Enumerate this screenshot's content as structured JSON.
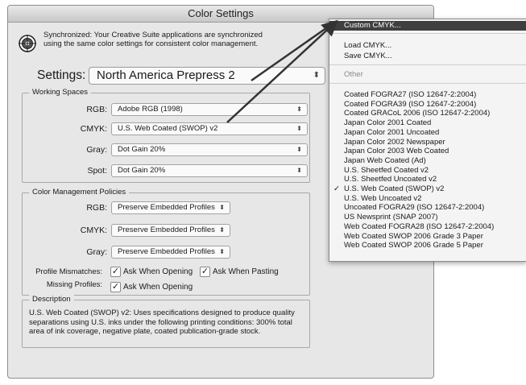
{
  "window": {
    "title": "Color Settings"
  },
  "sync": {
    "line1": "Synchronized: Your Creative Suite applications are synchronized",
    "line2": "using the same color settings for consistent color management."
  },
  "settings": {
    "label": "Settings:",
    "value": "North America Prepress 2"
  },
  "working_spaces": {
    "title": "Working Spaces",
    "rgb_label": "RGB:",
    "rgb_value": "Adobe RGB (1998)",
    "cmyk_label": "CMYK:",
    "cmyk_value": "U.S. Web Coated (SWOP) v2",
    "gray_label": "Gray:",
    "gray_value": "Dot Gain 20%",
    "spot_label": "Spot:",
    "spot_value": "Dot Gain 20%"
  },
  "policies": {
    "title": "Color Management Policies",
    "rgb_label": "RGB:",
    "rgb_value": "Preserve Embedded Profiles",
    "cmyk_label": "CMYK:",
    "cmyk_value": "Preserve Embedded Profiles",
    "gray_label": "Gray:",
    "gray_value": "Preserve Embedded Profiles",
    "mismatch_label": "Profile Mismatches:",
    "ask_opening": "Ask When Opening",
    "ask_pasting": "Ask When Pasting",
    "missing_label": "Missing Profiles:",
    "ask_opening_2": "Ask When Opening"
  },
  "description": {
    "title": "Description",
    "line1": "U.S. Web Coated (SWOP) v2:  Uses specifications designed to produce quality",
    "line2": "separations using U.S. inks under the following printing conditions: 300% total",
    "line3": "area of ink coverage, negative plate, coated publication-grade stock."
  },
  "menu": {
    "custom": "Custom CMYK...",
    "load": "Load CMYK...",
    "save": "Save CMYK...",
    "other": "Other",
    "profiles": [
      "Coated FOGRA27 (ISO 12647-2:2004)",
      "Coated FOGRA39 (ISO 12647-2:2004)",
      "Coated GRACoL 2006 (ISO 12647-2:2004)",
      "Japan Color 2001 Coated",
      "Japan Color 2001 Uncoated",
      "Japan Color 2002 Newspaper",
      "Japan Color 2003 Web Coated",
      "Japan Web Coated (Ad)",
      "U.S. Sheetfed Coated v2",
      "U.S. Sheetfed Uncoated v2",
      "U.S. Web Coated (SWOP) v2",
      "U.S. Web Uncoated v2",
      "Uncoated FOGRA29 (ISO 12647-2:2004)",
      "US Newsprint (SNAP 2007)",
      "Web Coated FOGRA28 (ISO 12647-2:2004)",
      "Web Coated SWOP 2006 Grade 3 Paper",
      "Web Coated SWOP 2006 Grade 5 Paper"
    ],
    "checked": "✓",
    "checked_index": 10
  },
  "icons": {
    "sync": "sync-target-icon",
    "updown": "up-down-arrows-icon",
    "check": "checkmark-icon"
  },
  "colors": {
    "highlight": "#3f3f3f",
    "window_bg": "#e7e7e7"
  }
}
